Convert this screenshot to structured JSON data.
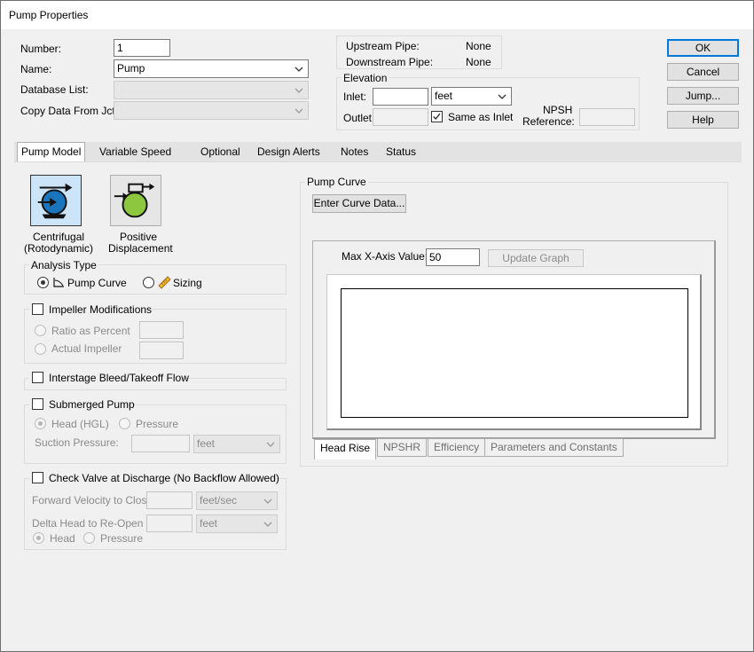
{
  "window": {
    "title": "Pump Properties"
  },
  "header": {
    "number_label": "Number:",
    "number_value": "1",
    "name_label": "Name:",
    "name_value": "Pump",
    "database_label": "Database List:",
    "database_value": "",
    "copy_label": "Copy Data From Jct...",
    "copy_value": ""
  },
  "pipes": {
    "upstream_label": "Upstream Pipe:",
    "upstream_value": "None",
    "downstream_label": "Downstream Pipe:",
    "downstream_value": "None"
  },
  "elevation": {
    "title": "Elevation",
    "inlet_label": "Inlet:",
    "inlet_value": "",
    "unit_value": "feet",
    "outlet_label": "Outlet:",
    "outlet_value": "",
    "same_as_inlet_label": "Same as Inlet",
    "same_as_inlet_checked": true,
    "npsh_label_line1": "NPSH",
    "npsh_label_line2": "Reference:",
    "npsh_value": ""
  },
  "buttons": {
    "ok": "OK",
    "cancel": "Cancel",
    "jump": "Jump...",
    "help": "Help"
  },
  "tabs": [
    {
      "label": "Pump Model",
      "active": true
    },
    {
      "label": "Variable Speed",
      "active": false
    },
    {
      "label": "Optional",
      "active": false
    },
    {
      "label": "Design Alerts",
      "active": false
    },
    {
      "label": "Notes",
      "active": false
    },
    {
      "label": "Status",
      "active": false
    }
  ],
  "pump_model": {
    "centrifugal_line1": "Centrifugal",
    "centrifugal_line2": "(Rotodynamic)",
    "positive_line1": "Positive",
    "positive_line2": "Displacement",
    "selected": "centrifugal",
    "colors": {
      "centrifugal": "#1b75bc",
      "positive": "#8dc63f",
      "selected_bg": "#cce4f7"
    }
  },
  "analysis_type": {
    "title": "Analysis Type",
    "pump_curve_label": "Pump Curve",
    "sizing_label": "Sizing",
    "selected": "pump_curve"
  },
  "impeller": {
    "title": "Impeller Modifications",
    "ratio_label": "Ratio as Percent",
    "actual_label": "Actual Impeller"
  },
  "interstage": {
    "title": "Interstage Bleed/Takeoff Flow"
  },
  "submerged": {
    "title": "Submerged Pump",
    "head_label": "Head (HGL)",
    "pressure_label": "Pressure",
    "suction_label": "Suction Pressure:",
    "suction_unit": "feet"
  },
  "check_valve": {
    "title": "Check Valve at Discharge (No Backflow Allowed)",
    "forward_label": "Forward Velocity to Close",
    "forward_unit": "feet/sec",
    "delta_label": "Delta Head to Re-Open",
    "delta_unit": "feet",
    "head_label": "Head",
    "pressure_label": "Pressure"
  },
  "pump_curve": {
    "title": "Pump Curve",
    "enter_button": "Enter Curve Data...",
    "max_x_label": "Max X-Axis Value:",
    "max_x_value": "50",
    "update_button": "Update Graph",
    "subtabs": [
      {
        "label": "Head Rise",
        "active": true
      },
      {
        "label": "NPSHR",
        "active": false
      },
      {
        "label": "Efficiency",
        "active": false
      },
      {
        "label": "Parameters and Constants",
        "active": false
      }
    ]
  }
}
